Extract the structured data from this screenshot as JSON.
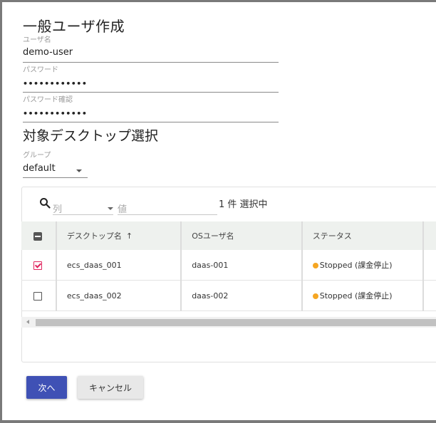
{
  "dialog": {
    "title": "一般ユーザ作成",
    "username": {
      "label": "ユーザ名",
      "value": "demo-user"
    },
    "password": {
      "label": "パスワード",
      "value": "••••••••••••"
    },
    "password_confirm": {
      "label": "パスワード確認",
      "value": "••••••••••••"
    }
  },
  "desktop_select": {
    "title": "対象デスクトップ選択",
    "group": {
      "label": "グループ",
      "value": "default"
    },
    "filter": {
      "column_placeholder": "列",
      "value_placeholder": "値",
      "selected_count": "1 件 選択中"
    },
    "table": {
      "headers": {
        "desktop_name": "デスクトップ名",
        "sort_indicator": "↑",
        "os_user": "OSユーザ名",
        "status": "ステータス"
      },
      "rows": [
        {
          "checked": true,
          "desktop_name": "ecs_daas_001",
          "os_user": "daas-001",
          "status": "Stopped (課金停止)"
        },
        {
          "checked": false,
          "desktop_name": "ecs_daas_002",
          "os_user": "daas-002",
          "status": "Stopped (課金停止)"
        }
      ]
    }
  },
  "buttons": {
    "next": "次へ",
    "cancel": "キャンセル"
  },
  "colors": {
    "primary": "#3f51b5",
    "checkbox_checked": "#e0245e",
    "status_stopped": "#f5a623",
    "header_bg": "#eef1ee"
  }
}
